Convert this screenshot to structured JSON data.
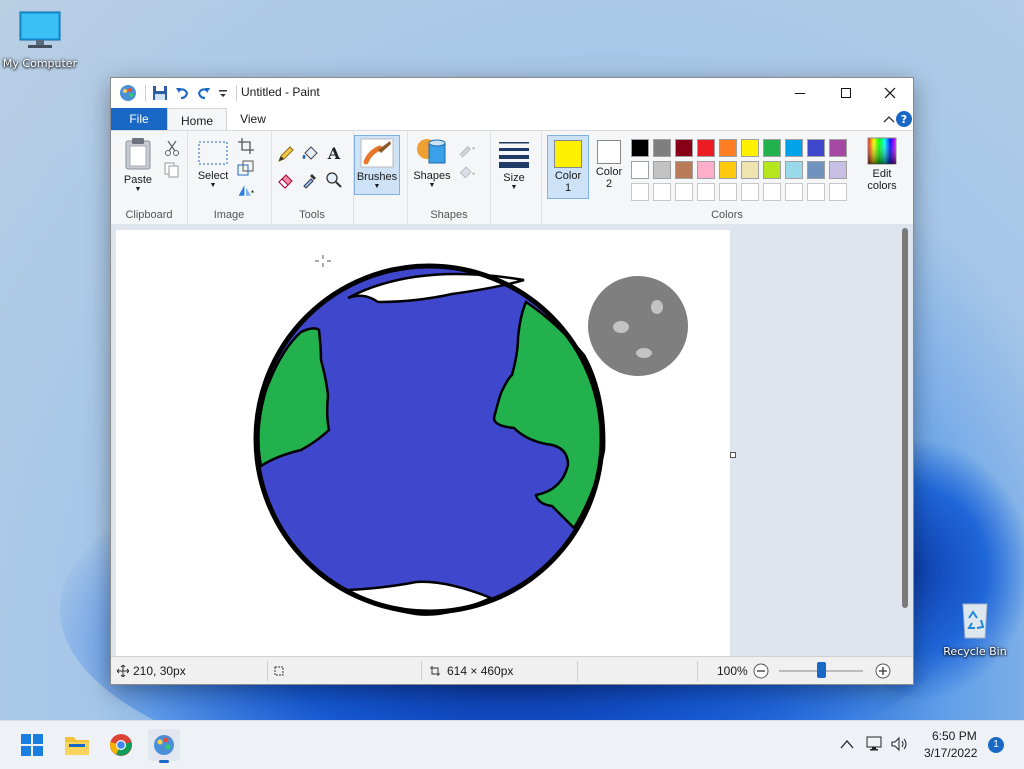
{
  "desktop": {
    "icons": [
      {
        "label": "My Computer"
      },
      {
        "label": "Recycle Bin"
      }
    ]
  },
  "window": {
    "title": "Untitled - Paint",
    "tabs": {
      "file": "File",
      "home": "Home",
      "view": "View"
    },
    "ribbon": {
      "clipboard": {
        "label": "Clipboard",
        "paste": "Paste"
      },
      "image": {
        "label": "Image",
        "select": "Select"
      },
      "tools": {
        "label": "Tools"
      },
      "brushes": {
        "label": "Brushes"
      },
      "shapes": {
        "label": "Shapes",
        "button": "Shapes"
      },
      "size": {
        "label": "Size"
      },
      "colors": {
        "label": "Colors",
        "color1": "Color\n1",
        "color1_line1": "Color",
        "color1_line2": "1",
        "color2_line1": "Color",
        "color2_line2": "2",
        "edit_line1": "Edit",
        "edit_line2": "colors",
        "color1_value": "#ffef00",
        "color2_value": "#ffffff",
        "palette_row1": [
          "#000000",
          "#7f7f7f",
          "#880015",
          "#ed1c24",
          "#ff7f27",
          "#fff200",
          "#22b14c",
          "#00a2e8",
          "#3f48cc",
          "#a349a4"
        ],
        "palette_row2": [
          "#ffffff",
          "#c3c3c3",
          "#b97a57",
          "#ffaec9",
          "#ffc90e",
          "#efe4b0",
          "#b5e61d",
          "#99d9ea",
          "#7092be",
          "#c8bfe7"
        ]
      }
    },
    "status": {
      "cursor_pos": "210, 30px",
      "canvas_size": "614 × 460px",
      "zoom": "100%",
      "zoom_level": 0.5
    }
  },
  "taskbar": {
    "time": "6:50 PM",
    "date": "3/17/2022",
    "notifications": "1"
  }
}
